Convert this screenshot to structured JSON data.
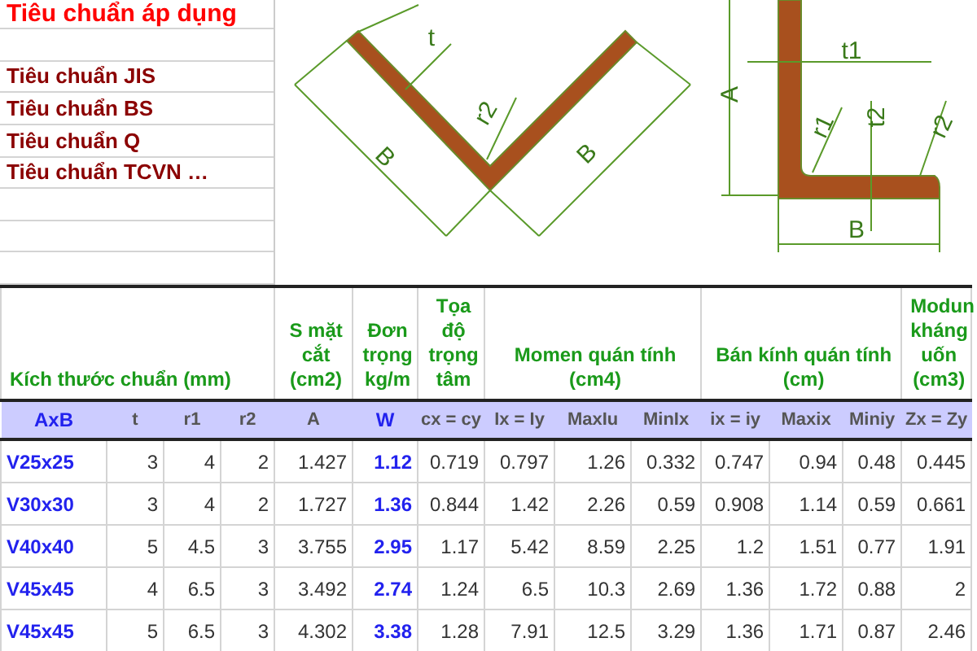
{
  "standards": {
    "title": "Tiêu chuẩn áp dụng",
    "items": [
      "Tiêu chuẩn JIS",
      "Tiêu chuẩn BS",
      "Tiêu chuẩn Q",
      "Tiêu chuẩn TCVN …"
    ]
  },
  "diagram": {
    "labels": [
      "t",
      "B",
      "r2",
      "B",
      "A",
      "t1",
      "r1",
      "t2",
      "r2",
      "B"
    ]
  },
  "table": {
    "groups": [
      {
        "label": "Kích thước chuẩn (mm)",
        "columns": [
          {
            "label": "AxB",
            "emphasis": true
          },
          {
            "label": "t",
            "emphasis": false
          },
          {
            "label": "r1",
            "emphasis": false
          },
          {
            "label": "r2",
            "emphasis": false
          }
        ]
      },
      {
        "label": "S mặt cắt (cm2)",
        "columns": [
          {
            "label": "A",
            "emphasis": false
          }
        ]
      },
      {
        "label": "Đơn trọng kg/m",
        "columns": [
          {
            "label": "W",
            "emphasis": true
          }
        ]
      },
      {
        "label": "Tọa độ trọng tâm",
        "columns": [
          {
            "label": "cx = cy",
            "emphasis": false
          }
        ]
      },
      {
        "label": "Momen quán tính (cm4)",
        "columns": [
          {
            "label": "Ix = Iy",
            "emphasis": false
          },
          {
            "label": "MaxIu",
            "emphasis": false
          },
          {
            "label": "MinIx",
            "emphasis": false
          }
        ]
      },
      {
        "label": "Bán kính quán tính (cm)",
        "columns": [
          {
            "label": "ix = iy",
            "emphasis": false
          },
          {
            "label": "Maxix",
            "emphasis": false
          },
          {
            "label": "Miniy",
            "emphasis": false
          }
        ]
      },
      {
        "label": "Modun kháng uốn (cm3)",
        "columns": [
          {
            "label": "Zx = Zy",
            "emphasis": false
          }
        ]
      }
    ],
    "rows": [
      [
        "V25x25",
        "3",
        "4",
        "2",
        "1.427",
        "1.12",
        "0.719",
        "0.797",
        "1.26",
        "0.332",
        "0.747",
        "0.94",
        "0.48",
        "0.445"
      ],
      [
        "V30x30",
        "3",
        "4",
        "2",
        "1.727",
        "1.36",
        "0.844",
        "1.42",
        "2.26",
        "0.59",
        "0.908",
        "1.14",
        "0.59",
        "0.661"
      ],
      [
        "V40x40",
        "5",
        "4.5",
        "3",
        "3.755",
        "2.95",
        "1.17",
        "5.42",
        "8.59",
        "2.25",
        "1.2",
        "1.51",
        "0.77",
        "1.91"
      ],
      [
        "V45x45",
        "4",
        "6.5",
        "3",
        "3.492",
        "2.74",
        "1.24",
        "6.5",
        "10.3",
        "2.69",
        "1.36",
        "1.72",
        "0.88",
        "2"
      ],
      [
        "V45x45",
        "5",
        "6.5",
        "3",
        "4.302",
        "3.38",
        "1.28",
        "7.91",
        "12.5",
        "3.29",
        "1.36",
        "1.71",
        "0.87",
        "2.46"
      ]
    ]
  }
}
